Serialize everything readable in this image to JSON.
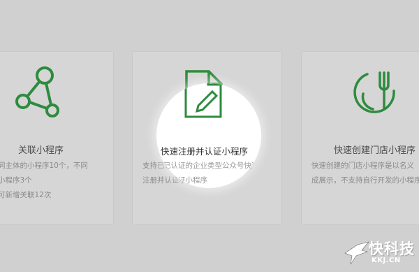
{
  "cards": {
    "left": {
      "title": "关联小程序",
      "desc": [
        "同主体的小程序10个，不同",
        "小程序3个",
        "可新增关联12次"
      ]
    },
    "middle": {
      "title": "快速注册并认证小程序",
      "desc": [
        "支持已认证的企业类型公众号快速",
        "注册并认证小程序"
      ]
    },
    "right": {
      "title": "快速创建门店小程序",
      "desc": [
        "快速创建的门店小程序是以名义",
        "成展示，不支持自行开发的小程序"
      ]
    }
  },
  "watermark": {
    "brand": "快科技",
    "url": "KKJ.CN"
  },
  "colors": {
    "accent_green": "#2e8b3e",
    "spotlight": "#ffffff"
  },
  "icons": {
    "left": "connected-nodes-icon",
    "middle": "document-edit-icon",
    "right": "fork-store-icon"
  }
}
